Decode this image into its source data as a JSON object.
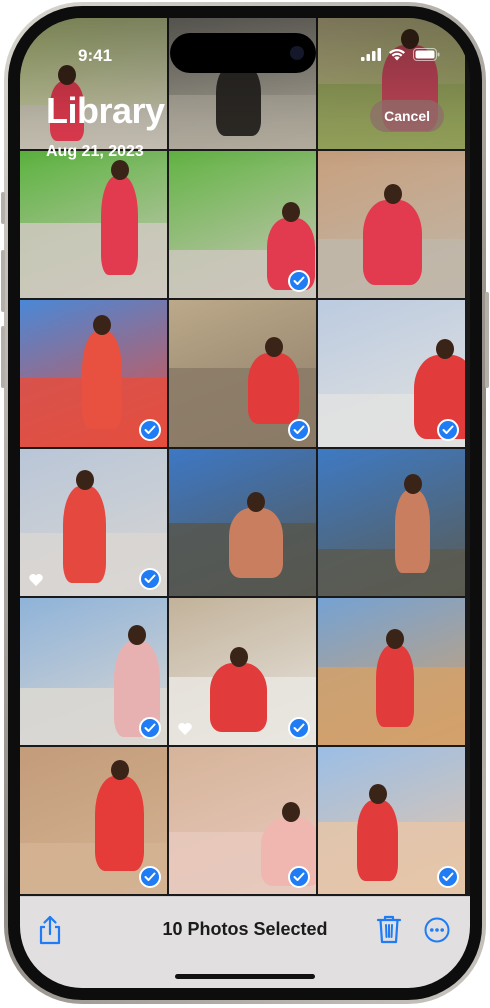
{
  "status_bar": {
    "time": "9:41"
  },
  "header": {
    "title": "Library",
    "date": "Aug 21, 2023",
    "cancel_label": "Cancel"
  },
  "toolbar": {
    "share_icon": "share-icon",
    "selected_label": "10 Photos Selected",
    "trash_icon": "trash-icon",
    "more_icon": "more-icon"
  },
  "colors": {
    "accent": "#1f7cf5",
    "toolbar_bg": "#eeecec"
  },
  "photos": [
    {
      "selected": false,
      "favorite": false,
      "sky": "#b7c87a",
      "ground": "#c8c2b6",
      "figure": "#e23b4f"
    },
    {
      "selected": false,
      "favorite": false,
      "sky": "#7c7a71",
      "ground": "#b6b0a2",
      "figure": "#2d2a26"
    },
    {
      "selected": false,
      "favorite": false,
      "sky": "#c1b48d",
      "ground": "#94a35a",
      "figure": "#c7485b"
    },
    {
      "selected": false,
      "favorite": false,
      "sky": "#5bb33e",
      "ground": "#cfc9bf",
      "figure": "#e23b4f"
    },
    {
      "selected": true,
      "favorite": false,
      "sky": "#62b443",
      "ground": "#cdc7bd",
      "figure": "#e23b4f"
    },
    {
      "selected": false,
      "favorite": false,
      "sky": "#c8a07e",
      "ground": "#bfb7aa",
      "figure": "#e23b4f"
    },
    {
      "selected": true,
      "favorite": false,
      "sky": "#4a88d6",
      "ground": "#e54e3e",
      "figure": "#e8513f"
    },
    {
      "selected": true,
      "favorite": false,
      "sky": "#bca98a",
      "ground": "#8a7a66",
      "figure": "#e23b3b"
    },
    {
      "selected": true,
      "favorite": false,
      "sky": "#bccbe0",
      "ground": "#e2e2e0",
      "figure": "#e23b3b"
    },
    {
      "selected": true,
      "favorite": true,
      "sky": "#b9c6d8",
      "ground": "#d9d6d2",
      "figure": "#e5483f"
    },
    {
      "selected": false,
      "favorite": false,
      "sky": "#3d78c5",
      "ground": "#56574f",
      "figure": "#c97f5f"
    },
    {
      "selected": false,
      "favorite": false,
      "sky": "#3e7ac4",
      "ground": "#5a5a50",
      "figure": "#c97f5f"
    },
    {
      "selected": true,
      "favorite": false,
      "sky": "#8fb3d9",
      "ground": "#dcd8d2",
      "figure": "#e8b1b1"
    },
    {
      "selected": true,
      "favorite": true,
      "sky": "#c2b29a",
      "ground": "#e9e6e1",
      "figure": "#e23b3b"
    },
    {
      "selected": false,
      "favorite": false,
      "sky": "#75a2d3",
      "ground": "#d4a16a",
      "figure": "#e23b3b"
    },
    {
      "selected": true,
      "favorite": false,
      "sky": "#c39c7a",
      "ground": "#d4b393",
      "figure": "#e53b39"
    },
    {
      "selected": true,
      "favorite": false,
      "sky": "#d6b49a",
      "ground": "#e8c9bd",
      "figure": "#f0b6b0"
    },
    {
      "selected": true,
      "favorite": false,
      "sky": "#9bbee6",
      "ground": "#e6c6a8",
      "figure": "#e23b3b"
    }
  ]
}
